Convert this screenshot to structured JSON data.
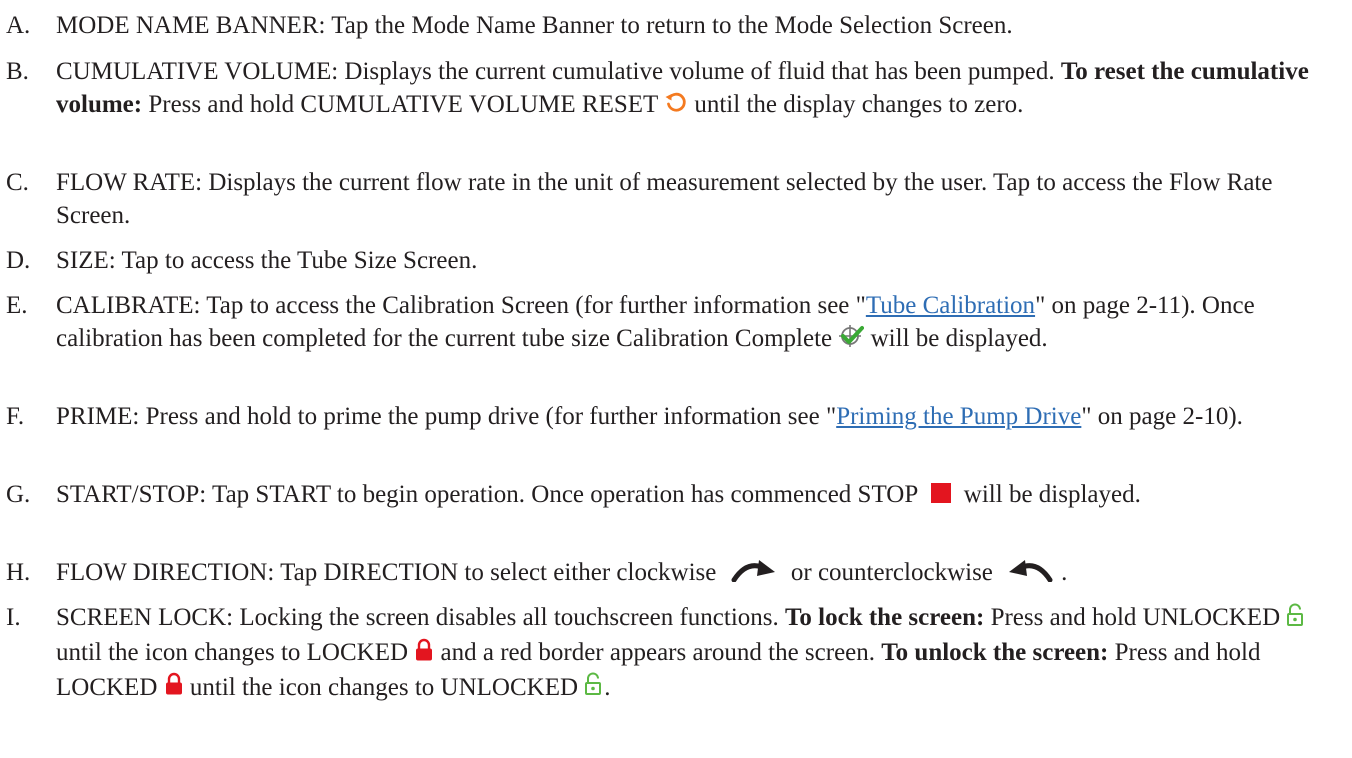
{
  "items": {
    "a": {
      "letter": "A.",
      "text": "MODE NAME BANNER: Tap the Mode Name Banner to return to the Mode Selection Screen."
    },
    "b": {
      "letter": "B.",
      "t1": "CUMULATIVE VOLUME: Displays the current cumulative volume of fluid that has been pumped. ",
      "bold1": "To reset the cumulative volume:",
      "t2": " Press and hold CUMULATIVE VOLUME RESET ",
      "t3": " until the display changes to zero."
    },
    "c": {
      "letter": "C.",
      "text": "FLOW RATE: Displays the current flow rate in the unit of measurement selected by the user. Tap to access the Flow Rate Screen."
    },
    "d": {
      "letter": "D.",
      "text": "SIZE: Tap to access the Tube Size Screen."
    },
    "e": {
      "letter": "E.",
      "t1": "CALIBRATE: Tap to access the Calibration Screen (for further information see \"",
      "link": "Tube Calibration",
      "t2": "\" on page 2-11). Once calibration has been completed for the current tube size Calibration Complete ",
      "t3": " will be displayed."
    },
    "f": {
      "letter": "F.",
      "t1": "PRIME: Press and hold to prime the pump drive (for further information see \"",
      "link": "Priming the Pump Drive",
      "t2": "\" on page 2-10)."
    },
    "g": {
      "letter": "G.",
      "t1": "START/STOP: Tap START to begin operation. Once operation has commenced STOP ",
      "t2": " will be displayed."
    },
    "h": {
      "letter": "H.",
      "t1": "FLOW DIRECTION: Tap DIRECTION to select either clockwise ",
      "t2": " or counterclockwise ",
      "t3": "."
    },
    "i": {
      "letter": "I.",
      "t1": "SCREEN LOCK: Locking the screen disables all touchscreen functions. ",
      "bold1": "To lock the screen:",
      "t2": " Press and hold UNLOCKED ",
      "t3": " until the icon changes to LOCKED ",
      "t4": " and a red border appears around the screen. ",
      "bold2": "To unlock the screen:",
      "t5": " Press and hold LOCKED ",
      "t6": " until the icon changes to UNLOCKED ",
      "t7": "."
    }
  },
  "colors": {
    "text": "#231f20",
    "link": "#2e6db4",
    "accent_orange": "#f47a20",
    "stop_red": "#e3151f",
    "unlock_green": "#5cb944",
    "check_green": "#3aa935"
  },
  "icons": [
    "reset-icon",
    "calibration-complete-icon",
    "stop-icon",
    "clockwise-icon",
    "counterclockwise-icon",
    "unlocked-icon",
    "locked-icon"
  ]
}
